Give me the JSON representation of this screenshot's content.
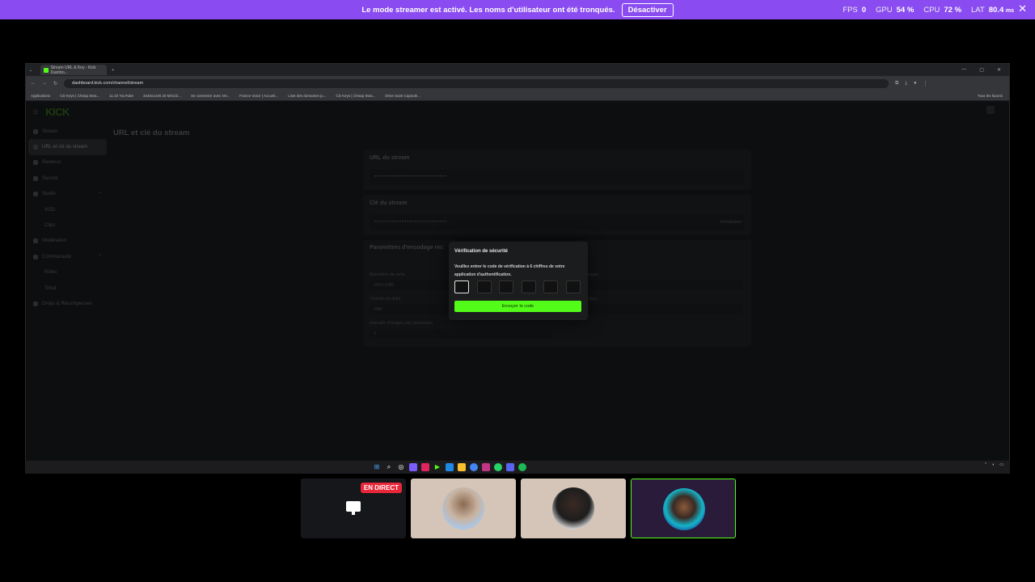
{
  "streamer_bar": {
    "message": "Le mode streamer est activé. Les noms d'utilisateur ont été tronqués.",
    "disable_label": "Désactiver"
  },
  "stats": {
    "fps_label": "FPS",
    "fps_value": "0",
    "gpu_label": "GPU",
    "gpu_value": "54 %",
    "cpu_label": "CPU",
    "cpu_value": "72 %",
    "lat_label": "LAT",
    "lat_value": "80.4",
    "lat_unit": "ms"
  },
  "browser": {
    "tab_title": "Stream URL & Key - Kick Dashbo...",
    "url": "dashboard.kick.com/channel/stream",
    "bookmarks": [
      "Applications",
      "CD Keys | Cheap Stea...",
      "11:10 YouTube",
      "3440x1440 20 MO1/2...",
      "Se connecter avec NV...",
      "France Voice | Accueil...",
      "Liste des domaines ju...",
      "CD Keys | Cheap Stea...",
      "Drive Saint Capsule..."
    ],
    "bookmarks_right": "Tous les favoris"
  },
  "kick": {
    "logo": "KICK",
    "nav": [
      {
        "label": "Stream",
        "active": false,
        "sub": false
      },
      {
        "label": "URL et clé du stream",
        "active": true,
        "sub": false
      },
      {
        "label": "Revenus",
        "active": false,
        "sub": false
      },
      {
        "label": "Succès",
        "active": false,
        "sub": false
      },
      {
        "label": "Studio",
        "active": false,
        "sub": false,
        "chevron": true
      },
      {
        "label": "VOD",
        "active": false,
        "sub": true
      },
      {
        "label": "Clips",
        "active": false,
        "sub": true
      },
      {
        "label": "Modération",
        "active": false,
        "sub": false
      },
      {
        "label": "Communauté",
        "active": false,
        "sub": false,
        "chevron": true
      },
      {
        "label": "Rôles",
        "active": false,
        "sub": true
      },
      {
        "label": "Tchat",
        "active": false,
        "sub": true
      },
      {
        "label": "Drops & Récompenses",
        "active": false,
        "sub": false
      }
    ],
    "page_title": "URL et clé du stream",
    "stream_url": {
      "label": "URL du stream",
      "value": "•••••••••••••••••••••••••••••"
    },
    "stream_key": {
      "label": "Clé du stream",
      "value": "•••••••••••••••••••••••••••••",
      "reset": "Réinitialiser"
    },
    "encoding": {
      "title": "Paramètres d'encodage rec",
      "resolution_label": "Résolution de sortie",
      "resolution_value": "1920×1080",
      "images_label": "images",
      "rate_label": "Contrôle du débit",
      "rate_value": "CBR",
      "kbps_label": "(Kbps)",
      "keyframe_label": "Intervalle d'images clés (secondes)",
      "keyframe_value": "2"
    }
  },
  "modal": {
    "title": "Vérification de sécurité",
    "description": "Veuillez entrer le code de vérification à 6 chiffres de votre application d'authentification.",
    "send_label": "Envoyer le code"
  },
  "call": {
    "live_badge": "EN DIRECT"
  },
  "colors": {
    "streamer_bar": "#8a4cf0",
    "kick_green": "#53fc18",
    "live_red": "#e8273a"
  }
}
